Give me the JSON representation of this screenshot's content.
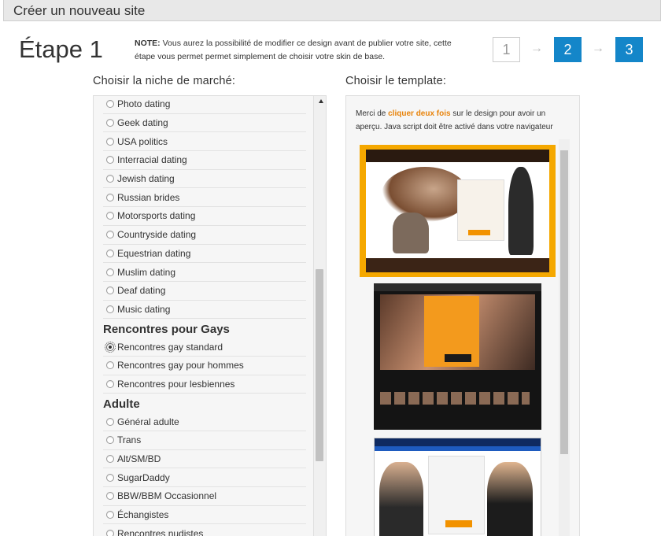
{
  "header": {
    "title": "Créer un nouveau site"
  },
  "step": {
    "title": "Étape 1",
    "note_label": "NOTE:",
    "note_text": " Vous aurez la possibilité de modifier ce design avant de publier votre site, cette étape vous permet permet simplement de choisir votre skin de base.",
    "steps": [
      "1",
      "2",
      "3"
    ],
    "arrow": "→"
  },
  "niche": {
    "heading": "Choisir la niche de marché:",
    "items_a": [
      "Photo dating",
      "Geek dating",
      "USA politics",
      "Interracial dating",
      "Jewish dating",
      "Russian brides",
      "Motorsports dating",
      "Countryside dating",
      "Equestrian dating",
      "Muslim dating",
      "Deaf dating",
      "Music dating"
    ],
    "group_gay": "Rencontres pour Gays",
    "items_gay": [
      "Rencontres gay standard",
      "Rencontres gay pour hommes",
      "Rencontres pour lesbiennes"
    ],
    "group_adult": "Adulte",
    "items_adult": [
      "Général adulte",
      "Trans",
      "Alt/SM/BD",
      "SugarDaddy",
      "BBW/BBM Occasionnel",
      "Échangistes",
      "Rencontres nudistes"
    ],
    "selected": "Rencontres gay standard"
  },
  "template": {
    "heading": "Choisir le template:",
    "intro_before": "Merci de ",
    "intro_highlight": "cliquer deux fois",
    "intro_after": " sur le design pour avoir un aperçu. Java script doit être activé dans votre navigateur"
  },
  "colors": {
    "accent": "#1486c9",
    "highlight": "#e8830a",
    "selected_template_border": "#f5a800"
  }
}
